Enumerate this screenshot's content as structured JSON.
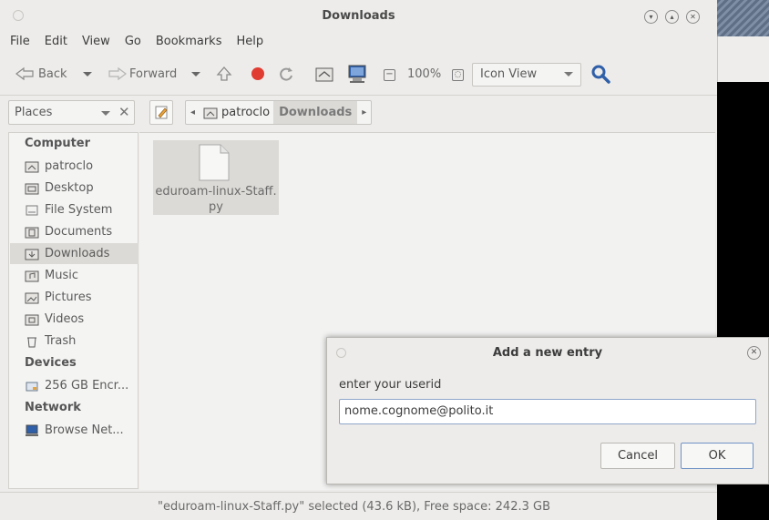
{
  "window": {
    "title": "Downloads"
  },
  "menu": [
    "File",
    "Edit",
    "View",
    "Go",
    "Bookmarks",
    "Help"
  ],
  "toolbar": {
    "back_label": "Back",
    "forward_label": "Forward",
    "zoom_level": "100%",
    "view_mode": "Icon View"
  },
  "places": {
    "label": "Places"
  },
  "breadcrumb": {
    "parent": "patroclo",
    "current": "Downloads"
  },
  "sidebar": {
    "computer_heading": "Computer",
    "computer_items": [
      "patroclo",
      "Desktop",
      "File System",
      "Documents",
      "Downloads",
      "Music",
      "Pictures",
      "Videos",
      "Trash"
    ],
    "selected": "Downloads",
    "devices_heading": "Devices",
    "device_items": [
      "256 GB Encr..."
    ],
    "network_heading": "Network",
    "network_items": [
      "Browse Net..."
    ]
  },
  "files": [
    {
      "name_line1": "eduroam-linux-Staff.",
      "name_line2": "py"
    }
  ],
  "status": "\"eduroam-linux-Staff.py\" selected (43.6 kB), Free space: 242.3 GB",
  "dialog": {
    "title": "Add a new entry",
    "prompt": "enter your userid",
    "value": "nome.cognome@polito.it",
    "cancel_label": "Cancel",
    "ok_label": "OK"
  },
  "colors": {
    "accent": "#3b6fc2",
    "selection": "#dcdad6"
  }
}
